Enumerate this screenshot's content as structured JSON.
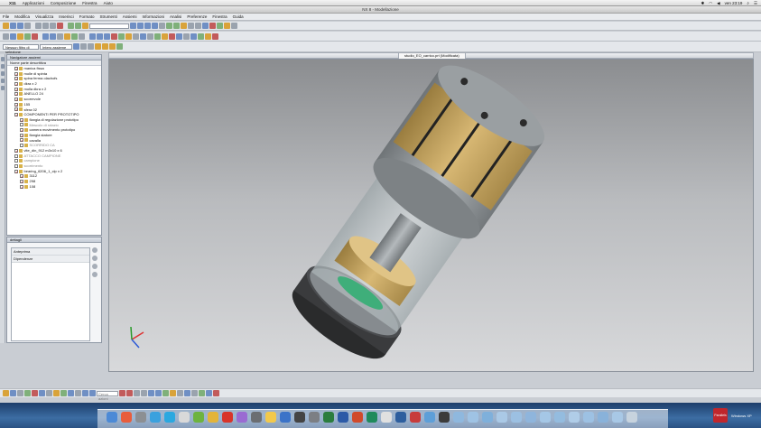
{
  "menubar": {
    "app": "X11",
    "items": [
      "Applicazioni",
      "Composizione",
      "Finestra",
      "Aiuto"
    ],
    "clock": "ven 23:19"
  },
  "window": {
    "title": "NX 8 - Modellazione"
  },
  "nx_menu": [
    "File",
    "Modifica",
    "Visualizza",
    "Inserisci",
    "Formato",
    "Strumenti",
    "Assiemi",
    "Informazioni",
    "Analisi",
    "Preferenze",
    "Finestra",
    "Guida"
  ],
  "toolbar": {
    "filter_combo": "Nessun filtro di selezione",
    "scope_combo": "Intero assieme"
  },
  "navigator": {
    "title": "Navigatore assiemi",
    "header": "Nome parte descrittiva",
    "nodes": [
      {
        "label": "manica fissa",
        "level": 1,
        "dim": false
      },
      {
        "label": "molle di spinta",
        "level": 1,
        "dim": false
      },
      {
        "label": "spina ferma olachofs",
        "level": 1,
        "dim": false
      },
      {
        "label": "dkra x 2",
        "level": 1,
        "dim": false
      },
      {
        "label": "molla dkra x 2",
        "level": 1,
        "dim": false
      },
      {
        "label": "ANELLO 24",
        "level": 1,
        "dim": false
      },
      {
        "label": "scorrevole",
        "level": 1,
        "dim": false
      },
      {
        "label": "155",
        "level": 1,
        "dim": false
      },
      {
        "label": "sfera 02",
        "level": 1,
        "dim": false
      },
      {
        "label": "COMPONENTI PER PROTOTIPO",
        "level": 1,
        "dim": false
      },
      {
        "label": "flangia di regolazione prototipo",
        "level": 2,
        "dim": false
      },
      {
        "label": "Mescolo di rotazio",
        "level": 2,
        "dim": true
      },
      {
        "label": "camera movimento prototipo",
        "level": 2,
        "dim": false
      },
      {
        "label": "flangia statore",
        "level": 2,
        "dim": false
      },
      {
        "label": "cavalla",
        "level": 2,
        "dim": false
      },
      {
        "label": "SCORRIDO CA",
        "level": 2,
        "dim": true
      },
      {
        "label": "vite_din_912 m3x10 x 6",
        "level": 1,
        "dim": false
      },
      {
        "label": "ATTACCO CAMPIONE",
        "level": 1,
        "dim": true
      },
      {
        "label": "campione",
        "level": 1,
        "dim": true
      },
      {
        "label": "scorrimento",
        "level": 1,
        "dim": true
      },
      {
        "label": "bearing_6206_1_clp x 2",
        "level": 1,
        "dim": false
      },
      {
        "label": "3112",
        "level": 2,
        "dim": false
      },
      {
        "label": "298",
        "level": 2,
        "dim": false
      },
      {
        "label": "108",
        "level": 2,
        "dim": false
      }
    ]
  },
  "details": {
    "title": "dettagli",
    "panel_label": "Anteprima",
    "panel_sublabel": "Dipendenze"
  },
  "viewport": {
    "tab_label": "studio_EO_carrico.prt (Modificata)"
  },
  "bottom": {
    "select_placeholder": "Cerca azioni"
  },
  "dock": {
    "badge": "Parallels",
    "label": "Windows XP"
  },
  "colors": {
    "brass": "#c9a65e",
    "steel": "#8e9396",
    "glass": "#bcc4c6",
    "green": "#3fae7a"
  }
}
